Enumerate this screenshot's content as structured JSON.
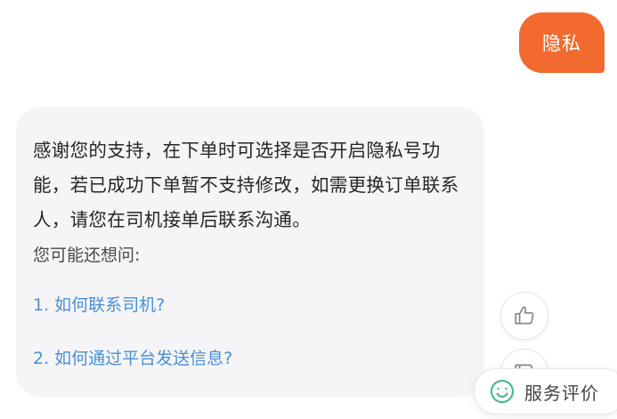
{
  "user_message": {
    "text": "隐私"
  },
  "bot_message": {
    "answer": "感谢您的支持，在下单时可选择是否开启隐私号功能，若已成功下单暂不支持修改，如需更换订单联系人，请您在司机接单后联系沟通。",
    "ask_label": "您可能还想问:",
    "suggestions": [
      "1. 如何联系司机?",
      "2. 如何通过平台发送信息?"
    ]
  },
  "feedback": {
    "like_icon": "thumbs-up-icon",
    "dislike_icon": "thumbs-down-icon"
  },
  "service_button": {
    "icon": "smiley-icon",
    "label": "服务评价"
  },
  "colors": {
    "user_bubble": "#f26a2f",
    "bot_bubble": "#f5f5f7",
    "suggestion_link": "#4a8fd6",
    "service_icon": "#4fb88e"
  }
}
